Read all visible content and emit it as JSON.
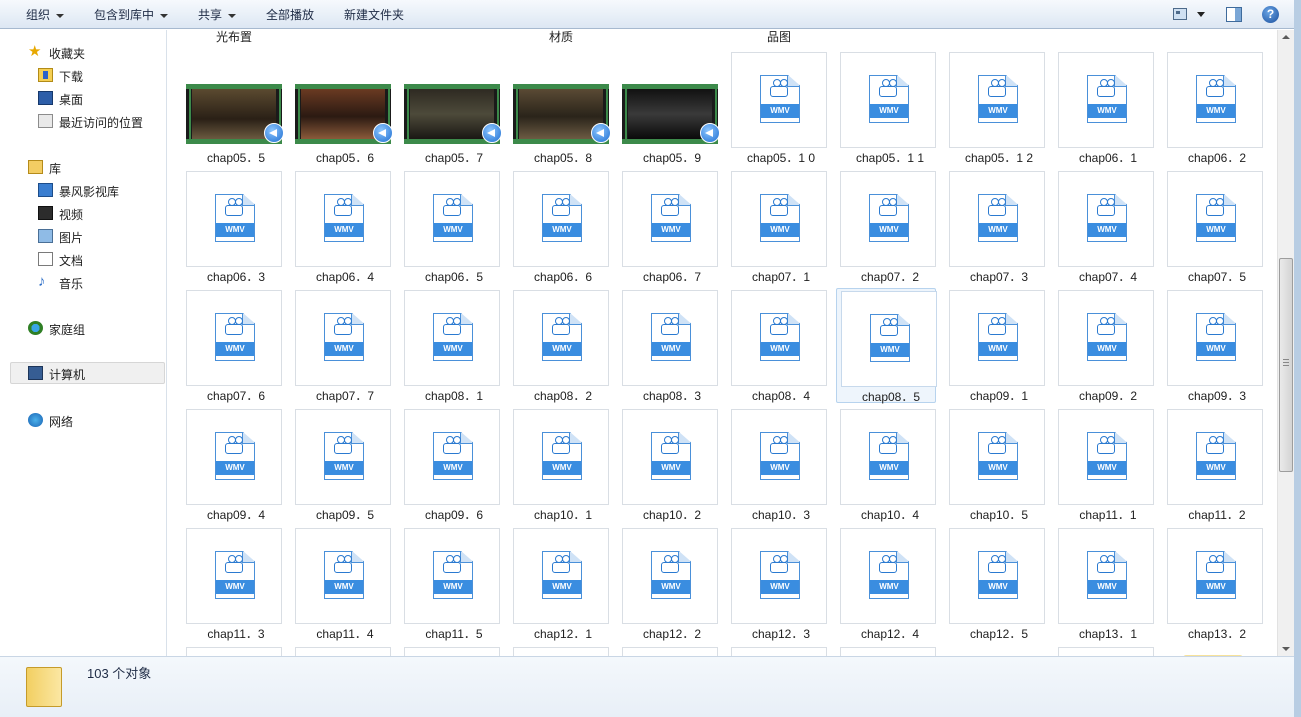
{
  "toolbar": {
    "organize": "组织",
    "include_library": "包含到库中",
    "share": "共享",
    "play_all": "全部播放",
    "new_folder": "新建文件夹"
  },
  "nav": {
    "favorites": "收藏夹",
    "downloads": "下载",
    "desktop": "桌面",
    "recent": "最近访问的位置",
    "libraries": "库",
    "storm": "暴风影视库",
    "videos": "视频",
    "pictures": "图片",
    "documents": "文档",
    "music": "音乐",
    "homegroup": "家庭组",
    "computer": "计算机",
    "network": "网络"
  },
  "group_labels": [
    "光布置",
    "材质",
    "品图"
  ],
  "wmv_label": "WMV",
  "files": [
    "chap05．5",
    "chap05．6",
    "chap05．7",
    "chap05．8",
    "chap05．9",
    "chap05．1 0",
    "chap05．1 1",
    "chap05．1 2",
    "chap06．1",
    "chap06．2",
    "chap06．3",
    "chap06．4",
    "chap06．5",
    "chap06．6",
    "chap06．7",
    "chap07．1",
    "chap07．2",
    "chap07．3",
    "chap07．4",
    "chap07．5",
    "chap07．6",
    "chap07．7",
    "chap08．1",
    "chap08．2",
    "chap08．3",
    "chap08．4",
    "chap08．5",
    "chap09．1",
    "chap09．2",
    "chap09．3",
    "chap09．4",
    "chap09．5",
    "chap09．6",
    "chap10．1",
    "chap10．2",
    "chap10．3",
    "chap10．4",
    "chap10．5",
    "chap11．1",
    "chap11．2",
    "chap11．3",
    "chap11．4",
    "chap11．5",
    "chap12．1",
    "chap12．2",
    "chap12．3",
    "chap12．4",
    "chap12．5",
    "chap13．1",
    "chap13．2"
  ],
  "thumbnail_count": 5,
  "selected_file": "chap08．5",
  "status": {
    "count": "103 个对象"
  },
  "colors": {
    "accent": "#3a8de0",
    "selection": "#eef5fc",
    "film_green": "#3c8a4a"
  },
  "icons": {
    "help": "?"
  }
}
